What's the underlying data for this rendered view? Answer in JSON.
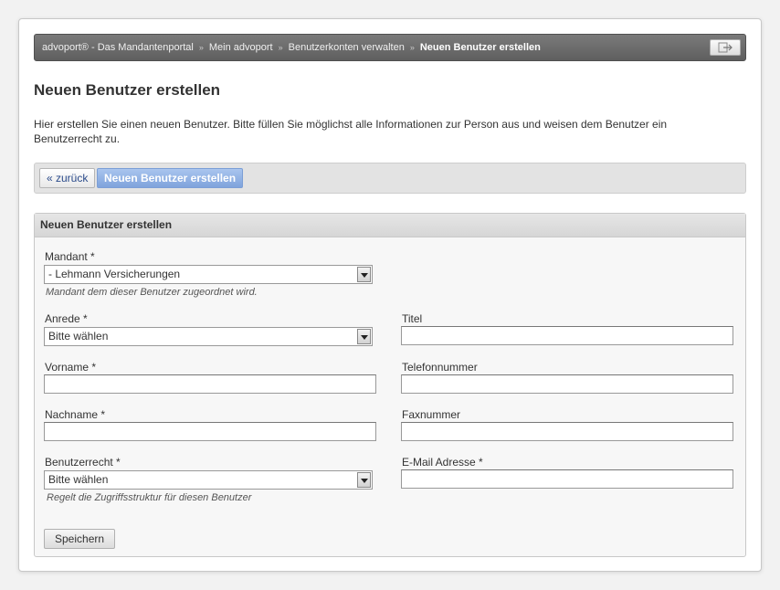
{
  "breadcrumb": {
    "items": [
      "advoport® - Das Mandantenportal",
      "Mein advoport",
      "Benutzerkonten verwalten"
    ],
    "current": "Neuen Benutzer erstellen",
    "separator": "»"
  },
  "page": {
    "title": "Neuen Benutzer erstellen",
    "intro": "Hier erstellen Sie einen neuen Benutzer. Bitte füllen Sie möglichst alle Informationen zur Person aus und weisen dem Benutzer ein Benutzerrecht zu."
  },
  "toolbar": {
    "back_label": "« zurück",
    "active_label": "Neuen Benutzer erstellen"
  },
  "form": {
    "panel_title": "Neuen Benutzer erstellen",
    "mandant": {
      "label": "Mandant *",
      "value": "- Lehmann Versicherungen",
      "hint": "Mandant dem dieser Benutzer zugeordnet wird."
    },
    "anrede": {
      "label": "Anrede *",
      "value": "Bitte wählen"
    },
    "titel": {
      "label": "Titel",
      "value": ""
    },
    "vorname": {
      "label": "Vorname *",
      "value": ""
    },
    "telefon": {
      "label": "Telefonnummer",
      "value": ""
    },
    "nachname": {
      "label": "Nachname *",
      "value": ""
    },
    "fax": {
      "label": "Faxnummer",
      "value": ""
    },
    "benutzerrecht": {
      "label": "Benutzerrecht *",
      "value": "Bitte wählen",
      "hint": "Regelt die Zugriffsstruktur für diesen Benutzer"
    },
    "email": {
      "label": "E-Mail Adresse *",
      "value": ""
    },
    "save_label": "Speichern"
  },
  "icons": {
    "logout": "logout-icon",
    "dropdown": "chevron-down-icon"
  },
  "colors": {
    "breadcrumb_bg": "#6b6b6b",
    "active_button": "#8eb0e4"
  }
}
